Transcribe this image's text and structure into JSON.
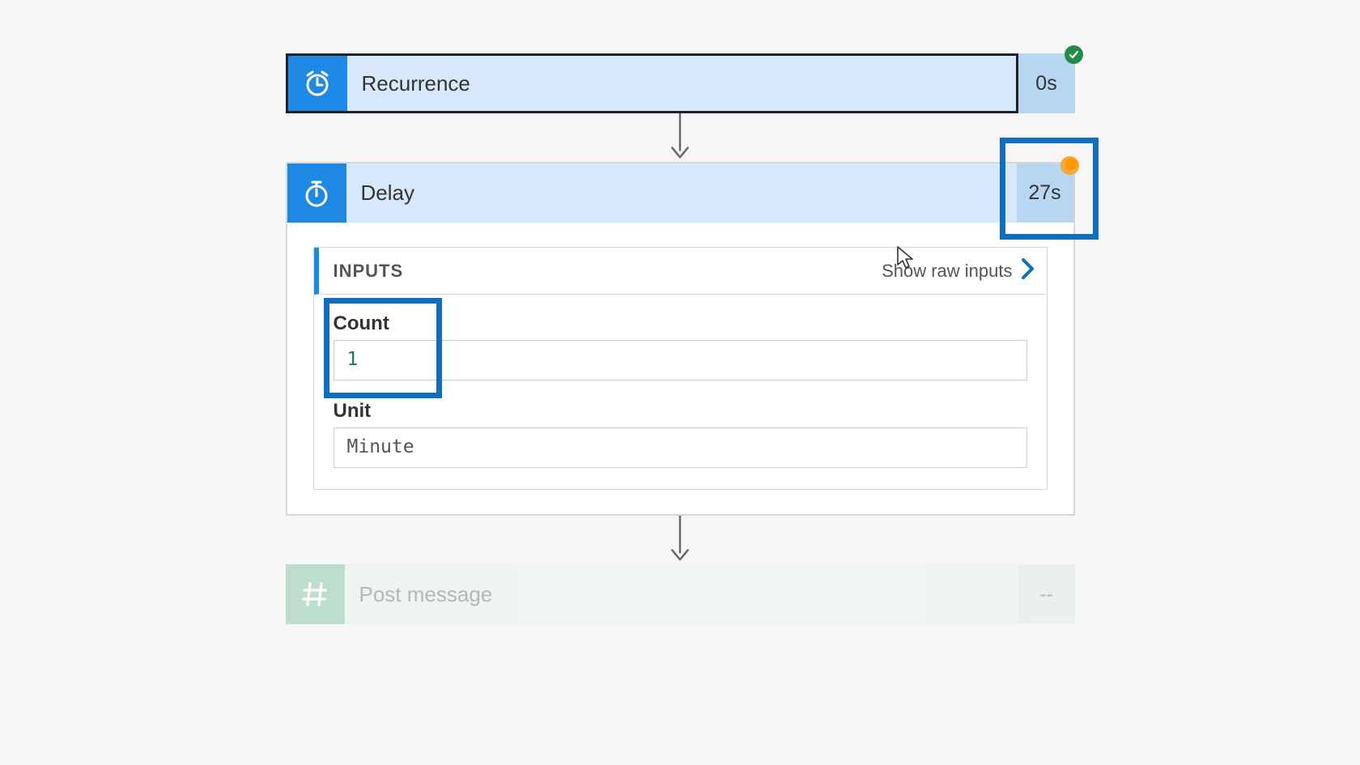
{
  "steps": {
    "recurrence": {
      "title": "Recurrence",
      "duration": "0s",
      "status": "success"
    },
    "delay": {
      "title": "Delay",
      "duration": "27s",
      "status": "running",
      "inputs": {
        "section_title": "INPUTS",
        "show_raw_label": "Show raw inputs",
        "fields": {
          "count": {
            "label": "Count",
            "value": "1"
          },
          "unit": {
            "label": "Unit",
            "value": "Minute"
          }
        }
      }
    },
    "post_message": {
      "title": "Post message",
      "duration": "--"
    }
  }
}
